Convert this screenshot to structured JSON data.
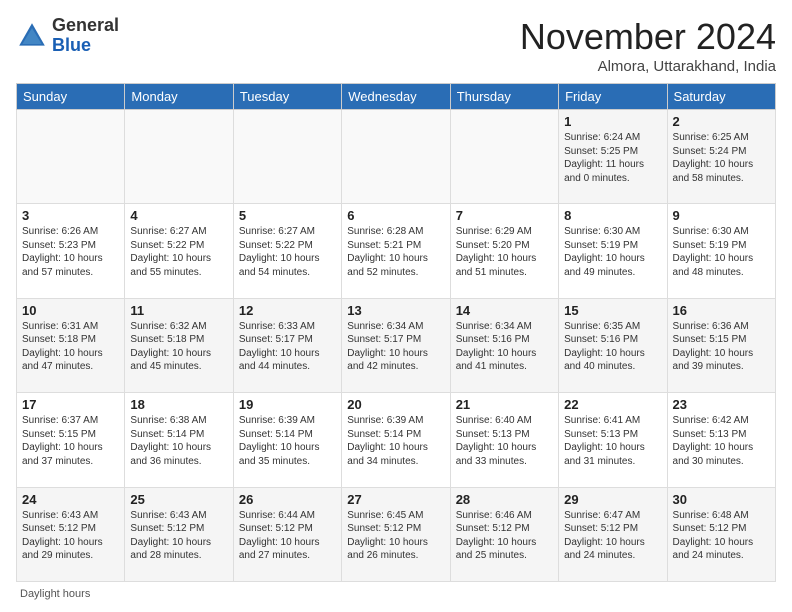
{
  "logo": {
    "general": "General",
    "blue": "Blue"
  },
  "header": {
    "month": "November 2024",
    "location": "Almora, Uttarakhand, India"
  },
  "weekdays": [
    "Sunday",
    "Monday",
    "Tuesday",
    "Wednesday",
    "Thursday",
    "Friday",
    "Saturday"
  ],
  "footer": {
    "label": "Daylight hours"
  },
  "weeks": [
    [
      {
        "day": "",
        "info": ""
      },
      {
        "day": "",
        "info": ""
      },
      {
        "day": "",
        "info": ""
      },
      {
        "day": "",
        "info": ""
      },
      {
        "day": "",
        "info": ""
      },
      {
        "day": "1",
        "info": "Sunrise: 6:24 AM\nSunset: 5:25 PM\nDaylight: 11 hours and 0 minutes."
      },
      {
        "day": "2",
        "info": "Sunrise: 6:25 AM\nSunset: 5:24 PM\nDaylight: 10 hours and 58 minutes."
      }
    ],
    [
      {
        "day": "3",
        "info": "Sunrise: 6:26 AM\nSunset: 5:23 PM\nDaylight: 10 hours and 57 minutes."
      },
      {
        "day": "4",
        "info": "Sunrise: 6:27 AM\nSunset: 5:22 PM\nDaylight: 10 hours and 55 minutes."
      },
      {
        "day": "5",
        "info": "Sunrise: 6:27 AM\nSunset: 5:22 PM\nDaylight: 10 hours and 54 minutes."
      },
      {
        "day": "6",
        "info": "Sunrise: 6:28 AM\nSunset: 5:21 PM\nDaylight: 10 hours and 52 minutes."
      },
      {
        "day": "7",
        "info": "Sunrise: 6:29 AM\nSunset: 5:20 PM\nDaylight: 10 hours and 51 minutes."
      },
      {
        "day": "8",
        "info": "Sunrise: 6:30 AM\nSunset: 5:19 PM\nDaylight: 10 hours and 49 minutes."
      },
      {
        "day": "9",
        "info": "Sunrise: 6:30 AM\nSunset: 5:19 PM\nDaylight: 10 hours and 48 minutes."
      }
    ],
    [
      {
        "day": "10",
        "info": "Sunrise: 6:31 AM\nSunset: 5:18 PM\nDaylight: 10 hours and 47 minutes."
      },
      {
        "day": "11",
        "info": "Sunrise: 6:32 AM\nSunset: 5:18 PM\nDaylight: 10 hours and 45 minutes."
      },
      {
        "day": "12",
        "info": "Sunrise: 6:33 AM\nSunset: 5:17 PM\nDaylight: 10 hours and 44 minutes."
      },
      {
        "day": "13",
        "info": "Sunrise: 6:34 AM\nSunset: 5:17 PM\nDaylight: 10 hours and 42 minutes."
      },
      {
        "day": "14",
        "info": "Sunrise: 6:34 AM\nSunset: 5:16 PM\nDaylight: 10 hours and 41 minutes."
      },
      {
        "day": "15",
        "info": "Sunrise: 6:35 AM\nSunset: 5:16 PM\nDaylight: 10 hours and 40 minutes."
      },
      {
        "day": "16",
        "info": "Sunrise: 6:36 AM\nSunset: 5:15 PM\nDaylight: 10 hours and 39 minutes."
      }
    ],
    [
      {
        "day": "17",
        "info": "Sunrise: 6:37 AM\nSunset: 5:15 PM\nDaylight: 10 hours and 37 minutes."
      },
      {
        "day": "18",
        "info": "Sunrise: 6:38 AM\nSunset: 5:14 PM\nDaylight: 10 hours and 36 minutes."
      },
      {
        "day": "19",
        "info": "Sunrise: 6:39 AM\nSunset: 5:14 PM\nDaylight: 10 hours and 35 minutes."
      },
      {
        "day": "20",
        "info": "Sunrise: 6:39 AM\nSunset: 5:14 PM\nDaylight: 10 hours and 34 minutes."
      },
      {
        "day": "21",
        "info": "Sunrise: 6:40 AM\nSunset: 5:13 PM\nDaylight: 10 hours and 33 minutes."
      },
      {
        "day": "22",
        "info": "Sunrise: 6:41 AM\nSunset: 5:13 PM\nDaylight: 10 hours and 31 minutes."
      },
      {
        "day": "23",
        "info": "Sunrise: 6:42 AM\nSunset: 5:13 PM\nDaylight: 10 hours and 30 minutes."
      }
    ],
    [
      {
        "day": "24",
        "info": "Sunrise: 6:43 AM\nSunset: 5:12 PM\nDaylight: 10 hours and 29 minutes."
      },
      {
        "day": "25",
        "info": "Sunrise: 6:43 AM\nSunset: 5:12 PM\nDaylight: 10 hours and 28 minutes."
      },
      {
        "day": "26",
        "info": "Sunrise: 6:44 AM\nSunset: 5:12 PM\nDaylight: 10 hours and 27 minutes."
      },
      {
        "day": "27",
        "info": "Sunrise: 6:45 AM\nSunset: 5:12 PM\nDaylight: 10 hours and 26 minutes."
      },
      {
        "day": "28",
        "info": "Sunrise: 6:46 AM\nSunset: 5:12 PM\nDaylight: 10 hours and 25 minutes."
      },
      {
        "day": "29",
        "info": "Sunrise: 6:47 AM\nSunset: 5:12 PM\nDaylight: 10 hours and 24 minutes."
      },
      {
        "day": "30",
        "info": "Sunrise: 6:48 AM\nSunset: 5:12 PM\nDaylight: 10 hours and 24 minutes."
      }
    ]
  ]
}
